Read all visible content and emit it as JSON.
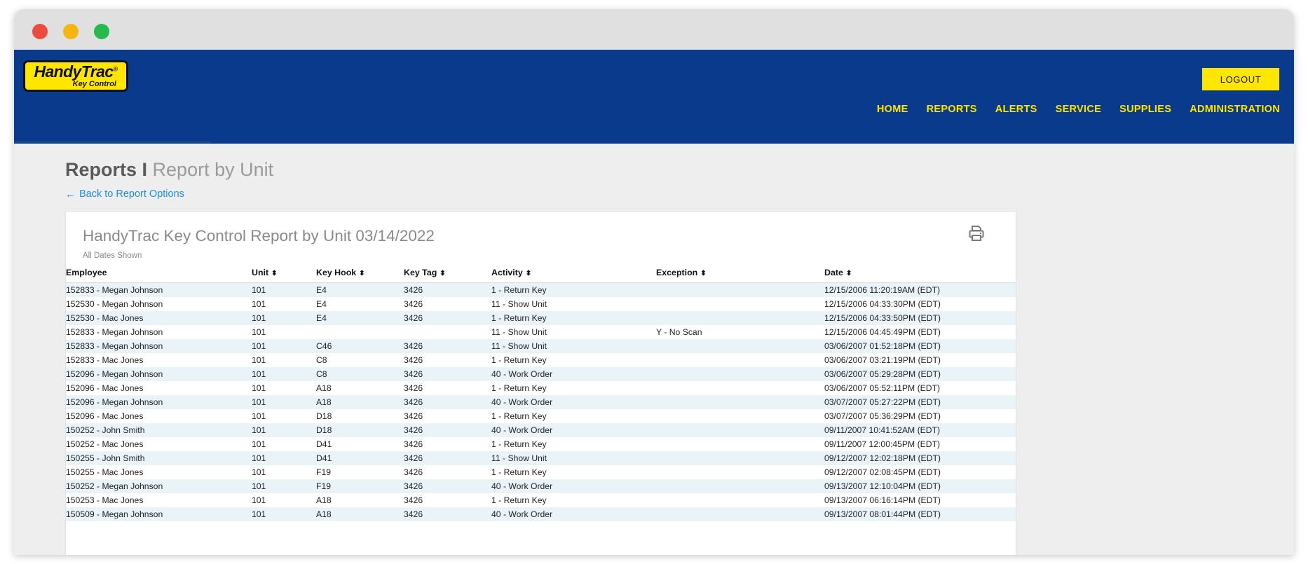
{
  "window": {
    "traffic_lights": [
      {
        "name": "close",
        "color": "#ed4b40"
      },
      {
        "name": "minimize",
        "color": "#f6b513"
      },
      {
        "name": "zoom",
        "color": "#29b84b"
      }
    ]
  },
  "header": {
    "logo_main": "HandyTrac",
    "logo_registered": "®",
    "logo_sub": "Key Control",
    "logout_label": "LOGOUT",
    "nav_items": [
      {
        "label": "HOME"
      },
      {
        "label": "REPORTS"
      },
      {
        "label": "ALERTS"
      },
      {
        "label": "SERVICE"
      },
      {
        "label": "SUPPLIES"
      },
      {
        "label": "ADMINISTRATION"
      }
    ],
    "brand_blue": "#0a3a8c",
    "accent_yellow": "#ffe600"
  },
  "page": {
    "title_strong": "Reports I",
    "title_rest": " Report by Unit",
    "back_link": "Back to Report Options",
    "back_arrow_icon": "←",
    "link_color": "#1a8fe0"
  },
  "report": {
    "title": "HandyTrac Key Control Report by Unit 03/14/2022",
    "subtitle": "All Dates Shown",
    "print_icon": "printer-icon",
    "sort_icon": "⬍",
    "columns": [
      {
        "key": "employee",
        "label": "Employee",
        "sortable": false
      },
      {
        "key": "unit",
        "label": "Unit",
        "sortable": true
      },
      {
        "key": "key_hook",
        "label": "Key Hook",
        "sortable": true
      },
      {
        "key": "key_tag",
        "label": "Key Tag",
        "sortable": true
      },
      {
        "key": "activity",
        "label": "Activity",
        "sortable": true
      },
      {
        "key": "exception",
        "label": "Exception",
        "sortable": true
      },
      {
        "key": "date",
        "label": "Date",
        "sortable": true
      }
    ],
    "rows": [
      {
        "employee": "152833 - Megan Johnson",
        "unit": "101",
        "key_hook": "E4",
        "key_tag": "3426",
        "activity": "1 - Return Key",
        "exception": "",
        "date": "12/15/2006 11:20:19AM (EDT)"
      },
      {
        "employee": "152530 - Megan Johnson",
        "unit": "101",
        "key_hook": "E4",
        "key_tag": "3426",
        "activity": "11 - Show Unit",
        "exception": "",
        "date": "12/15/2006 04:33:30PM (EDT)"
      },
      {
        "employee": "152530 - Mac Jones",
        "unit": "101",
        "key_hook": "E4",
        "key_tag": "3426",
        "activity": "1 - Return Key",
        "exception": "",
        "date": "12/15/2006 04:33:50PM (EDT)"
      },
      {
        "employee": "152833 - Megan Johnson",
        "unit": "101",
        "key_hook": "",
        "key_tag": "",
        "activity": "11 - Show Unit",
        "exception": "Y - No Scan",
        "date": "12/15/2006 04:45:49PM (EDT)"
      },
      {
        "employee": "152833 - Megan Johnson",
        "unit": "101",
        "key_hook": "C46",
        "key_tag": "3426",
        "activity": "11 - Show Unit",
        "exception": "",
        "date": "03/06/2007 01:52:18PM (EDT)"
      },
      {
        "employee": "152833 - Mac Jones",
        "unit": "101",
        "key_hook": "C8",
        "key_tag": "3426",
        "activity": "1 - Return Key",
        "exception": "",
        "date": "03/06/2007 03:21:19PM (EDT)"
      },
      {
        "employee": "152096 - Megan Johnson",
        "unit": "101",
        "key_hook": "C8",
        "key_tag": "3426",
        "activity": "40 - Work Order",
        "exception": "",
        "date": "03/06/2007 05:29:28PM (EDT)"
      },
      {
        "employee": "152096 - Mac Jones",
        "unit": "101",
        "key_hook": "A18",
        "key_tag": "3426",
        "activity": "1 - Return Key",
        "exception": "",
        "date": "03/06/2007 05:52:11PM (EDT)"
      },
      {
        "employee": "152096 - Megan Johnson",
        "unit": "101",
        "key_hook": "A18",
        "key_tag": "3426",
        "activity": "40 - Work Order",
        "exception": "",
        "date": "03/07/2007 05:27:22PM (EDT)"
      },
      {
        "employee": "152096 - Mac Jones",
        "unit": "101",
        "key_hook": "D18",
        "key_tag": "3426",
        "activity": "1 - Return Key",
        "exception": "",
        "date": "03/07/2007 05:36:29PM (EDT)"
      },
      {
        "employee": "150252 - John Smith",
        "unit": "101",
        "key_hook": "D18",
        "key_tag": "3426",
        "activity": "40 - Work Order",
        "exception": "",
        "date": "09/11/2007 10:41:52AM (EDT)"
      },
      {
        "employee": "150252 - Mac Jones",
        "unit": "101",
        "key_hook": "D41",
        "key_tag": "3426",
        "activity": "1 - Return Key",
        "exception": "",
        "date": "09/11/2007 12:00:45PM (EDT)"
      },
      {
        "employee": "150255 - John Smith",
        "unit": "101",
        "key_hook": "D41",
        "key_tag": "3426",
        "activity": "11 - Show Unit",
        "exception": "",
        "date": "09/12/2007 12:02:18PM (EDT)"
      },
      {
        "employee": "150255 - Mac Jones",
        "unit": "101",
        "key_hook": "F19",
        "key_tag": "3426",
        "activity": "1 - Return Key",
        "exception": "",
        "date": "09/12/2007 02:08:45PM (EDT)"
      },
      {
        "employee": "150252 - Megan Johnson",
        "unit": "101",
        "key_hook": "F19",
        "key_tag": "3426",
        "activity": "40 - Work Order",
        "exception": "",
        "date": "09/13/2007 12:10:04PM (EDT)"
      },
      {
        "employee": "150253 - Mac Jones",
        "unit": "101",
        "key_hook": "A18",
        "key_tag": "3426",
        "activity": "1 - Return Key",
        "exception": "",
        "date": "09/13/2007 06:16:14PM (EDT)"
      },
      {
        "employee": "150509 - Megan Johnson",
        "unit": "101",
        "key_hook": "A18",
        "key_tag": "3426",
        "activity": "40 - Work Order",
        "exception": "",
        "date": "09/13/2007 08:01:44PM (EDT)"
      }
    ]
  }
}
